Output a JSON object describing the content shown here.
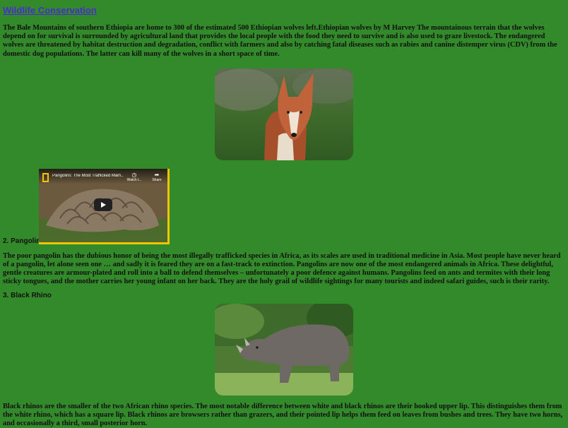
{
  "page": {
    "title": "Wildlife Conservation"
  },
  "wolf": {
    "paragraph": "The Bale Mountains of southern Ethiopia are home to 300 of the estimated 500 Ethiopian wolves left.Ethiopian wolves by M Harvey The mountainous terrain that the wolves depend on for survival is surrounded by agricultural land that provides the local people with the food they need to survive and is also used to graze livestock. The endangered wolves are threatened by habitat destruction and degradation, conflict with farmers and also by catching fatal diseases such as rabies and canine distemper virus (CDV) from the domestic dog populations. The latter can kill many of the wolves in a short space of time."
  },
  "pangolin": {
    "heading": "2. Pangolin",
    "video_title": "Pangolins: The Most Trafficked Mam...",
    "watch_label": "Watch l...",
    "share_label": "Share",
    "paragraph": "The poor pangolin has the dubious honor of being the most illegally trafficked species in Africa, as its scales are used in traditional medicine in Asia. Most people have never heard of a pangolin, let alone seen one … and sadly it is feared they are on a fast-track to extinction. Pangolins are now one of the most endangered animals in Africa. These delightful, gentle creatures are armour-plated and roll into a ball to defend themselves – unfortunately a poor defence against humans. Pangolins feed on ants and termites with their long sticky tongues, and the mother carries her young infant on her back. They are the holy grail of wildlife sightings for many tourists and indeed safari guides, such is their rarity."
  },
  "rhino": {
    "heading": "3. Black Rhino",
    "paragraph": "Black rhinos are the smaller of the two African rhino species. The most notable difference between white and black rhinos are their hooked upper lip. This distinguishes them from the white rhino, which has a square lip. Black rhinos are browsers rather than grazers, and their pointed lip helps them feed on leaves from bushes and trees. They have two horns, and occasionally a third, small posterior horn."
  },
  "colors": {
    "background": "#338a2a",
    "link": "#4a2bd0",
    "ng_yellow": "#f2c500"
  }
}
